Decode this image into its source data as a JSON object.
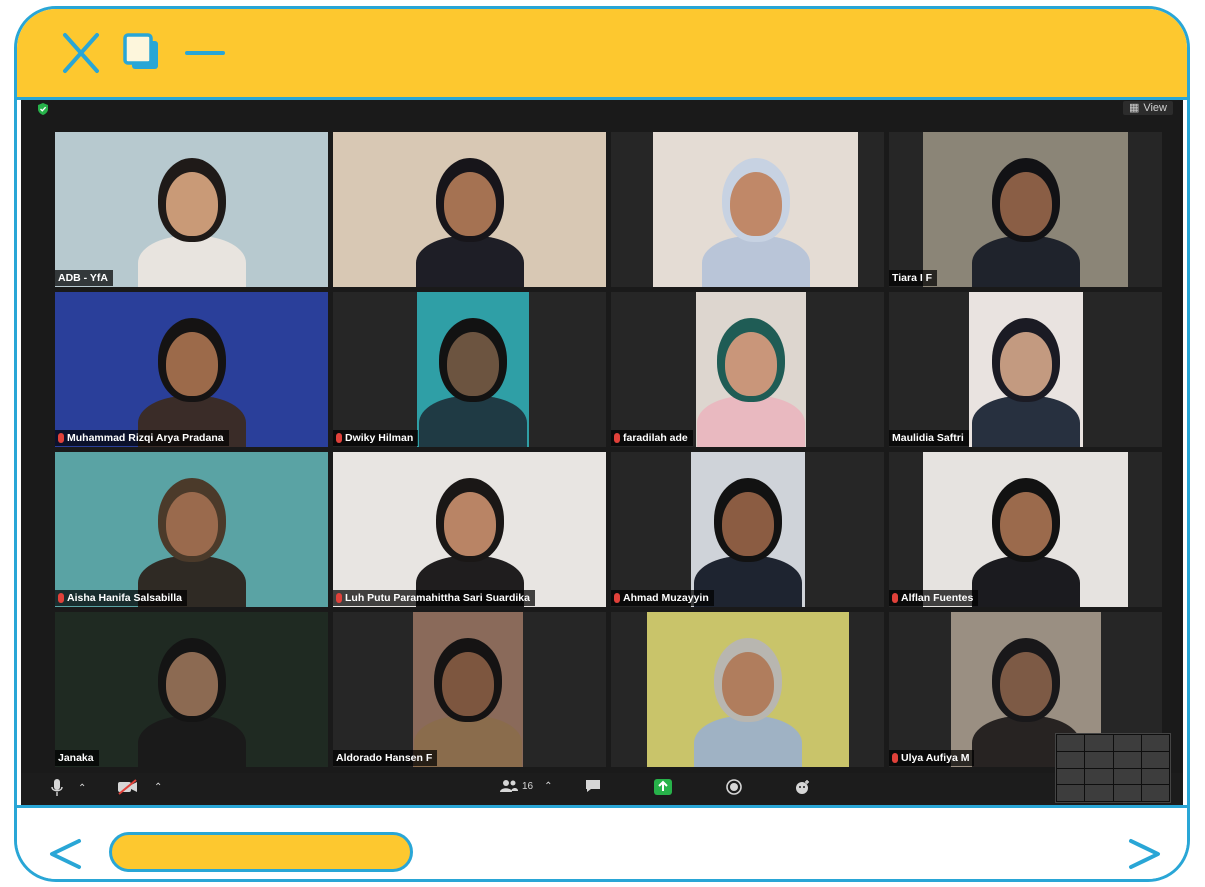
{
  "window": {
    "controls": [
      "close-icon",
      "restore-icon",
      "minimize-icon"
    ],
    "colors": {
      "frame_border": "#29a6d6",
      "title_bar": "#fdc82f",
      "scroll_thumb": "#fdc82f"
    }
  },
  "meeting": {
    "view_label": "View",
    "participant_count": "16",
    "participants": [
      {
        "name": "ADB - YfA",
        "muted": false,
        "bg": "#b7c9cf",
        "head": "#c99a77",
        "clothes": "#e8e4df",
        "hair": "#1f1a18"
      },
      {
        "name": "",
        "muted": false,
        "bg": "#d8c8b4",
        "head": "#a57252",
        "clothes": "#1e1e26",
        "hair": "#17151a"
      },
      {
        "name": "",
        "muted": false,
        "bg": "#e4dcd4",
        "head": "#c08868",
        "clothes": "#b9c5d8",
        "hair": "#c7d2e2"
      },
      {
        "name": "Tiara I F",
        "muted": false,
        "bg": "#8b8577",
        "head": "#8a5e45",
        "clothes": "#1f232c",
        "hair": "#121215"
      },
      {
        "name": "Muhammad Rizqi Arya Pradana",
        "muted": true,
        "bg": "#2a3f9a",
        "head": "#9c6a4a",
        "clothes": "#3a2c28",
        "hair": "#151313"
      },
      {
        "name": "Dwiky Hilman",
        "muted": true,
        "bg": "#2f9fa6",
        "head": "#6c5440",
        "clothes": "#1f3a44",
        "hair": "#121212"
      },
      {
        "name": "faradilah ade",
        "muted": true,
        "bg": "#ddd6cf",
        "head": "#c9967a",
        "clothes": "#e9b9c0",
        "hair": "#1f5c55"
      },
      {
        "name": "Maulidia Saftri",
        "muted": false,
        "bg": "#e9e3e0",
        "head": "#c39a80",
        "clothes": "#27303f",
        "hair": "#1b1b24"
      },
      {
        "name": "Aisha Hanifa Salsabilla",
        "muted": true,
        "bg": "#5aa3a4",
        "head": "#9a6a4d",
        "clothes": "#2f2a24",
        "hair": "#4b3a2a"
      },
      {
        "name": "Luh Putu Paramahittha Sari Suardika",
        "muted": true,
        "bg": "#e8e5e2",
        "head": "#b98465",
        "clothes": "#1f1d1e",
        "hair": "#1a1716"
      },
      {
        "name": "Ahmad Muzayyin",
        "muted": true,
        "bg": "#cfd3d9",
        "head": "#8b5c42",
        "clothes": "#1e2430",
        "hair": "#121212"
      },
      {
        "name": "Alflan Fuentes",
        "muted": true,
        "bg": "#e6e3e0",
        "head": "#9b6a4c",
        "clothes": "#1b1b1f",
        "hair": "#121212"
      },
      {
        "name": "Janaka",
        "muted": false,
        "bg": "#1f2a22",
        "head": "#8c6a52",
        "clothes": "#1a1a1a",
        "hair": "#141414"
      },
      {
        "name": "Aldorado Hansen F",
        "muted": false,
        "bg": "#8a6a5a",
        "head": "#7d563f",
        "clothes": "#8a6c4c",
        "hair": "#151313"
      },
      {
        "name": "",
        "muted": false,
        "bg": "#c9c46a",
        "head": "#b07d5d",
        "clothes": "#9fb2c4",
        "hair": "#b8b6b0"
      },
      {
        "name": "Ulya Aufiya M",
        "muted": true,
        "bg": "#9a8f82",
        "head": "#7d5a45",
        "clothes": "#272322",
        "hair": "#19181a"
      }
    ]
  }
}
